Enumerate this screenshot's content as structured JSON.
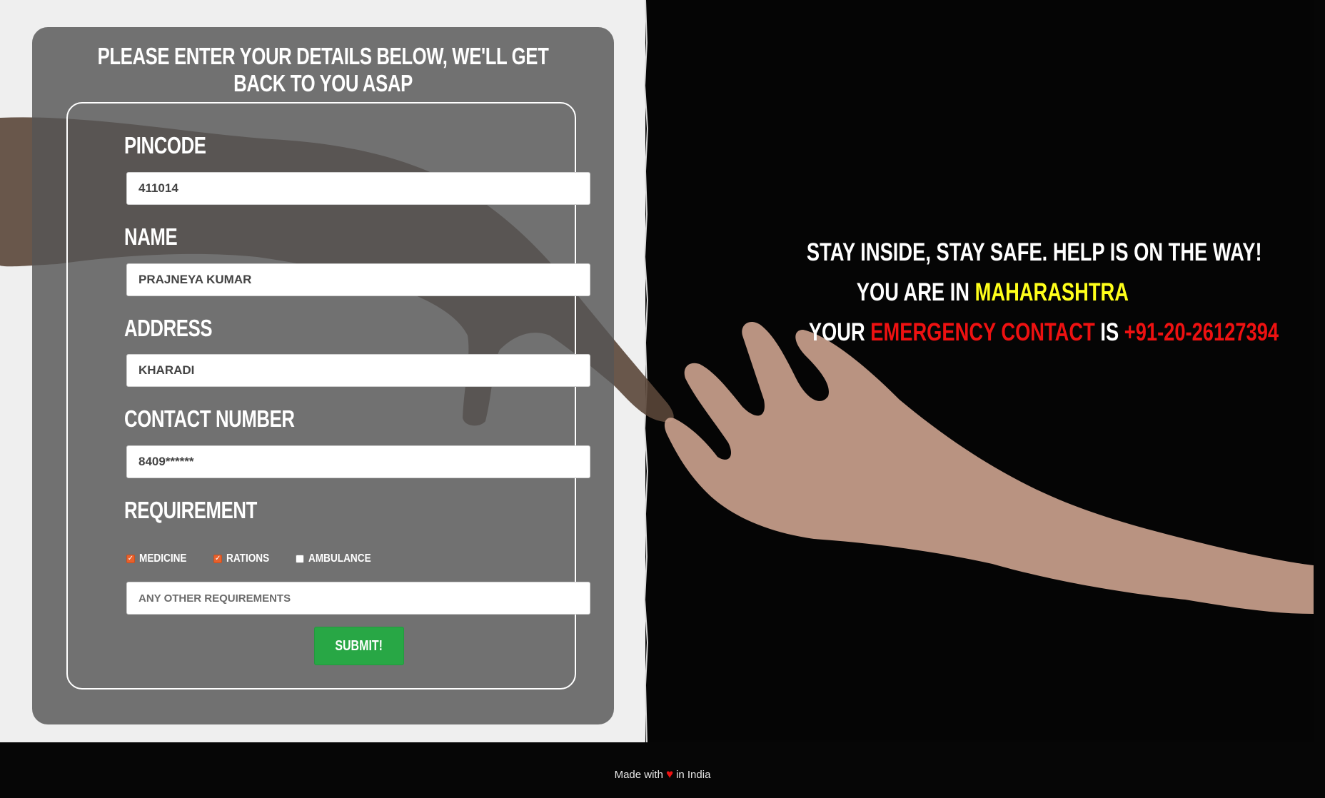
{
  "form": {
    "title": "Please enter your details below, we'll get back to you asap",
    "pincode": {
      "label": "Pincode",
      "value": "411014"
    },
    "name": {
      "label": "Name",
      "value": "PRAJNEYA KUMAR"
    },
    "address": {
      "label": "Address",
      "value": "KHARADI"
    },
    "contact": {
      "label": "Contact Number",
      "value": "8409******"
    },
    "requirement": {
      "label": "Requirement",
      "options": [
        {
          "label": "Medicine",
          "checked": true
        },
        {
          "label": "Rations",
          "checked": true
        },
        {
          "label": "Ambulance",
          "checked": false
        }
      ],
      "other_placeholder": "ANY OTHER REQUIREMENTS"
    },
    "submit_label": "Submit!"
  },
  "message": {
    "line1": "Stay inside, stay safe. Help is on the way!",
    "line2_prefix": "You are in",
    "state": "Maharashtra",
    "line3_prefix": "Your",
    "emergency_label": "Emergency Contact",
    "is_word": "is",
    "phone": "+91-20-26127394"
  },
  "footer": {
    "made_with": "Made with",
    "in_india": "in India",
    "heart_icon": "heart-icon"
  },
  "colors": {
    "accent_yellow": "#ffff1a",
    "accent_red": "#ee1111",
    "submit_green": "#28a745",
    "checkbox_orange": "#e8612c"
  }
}
